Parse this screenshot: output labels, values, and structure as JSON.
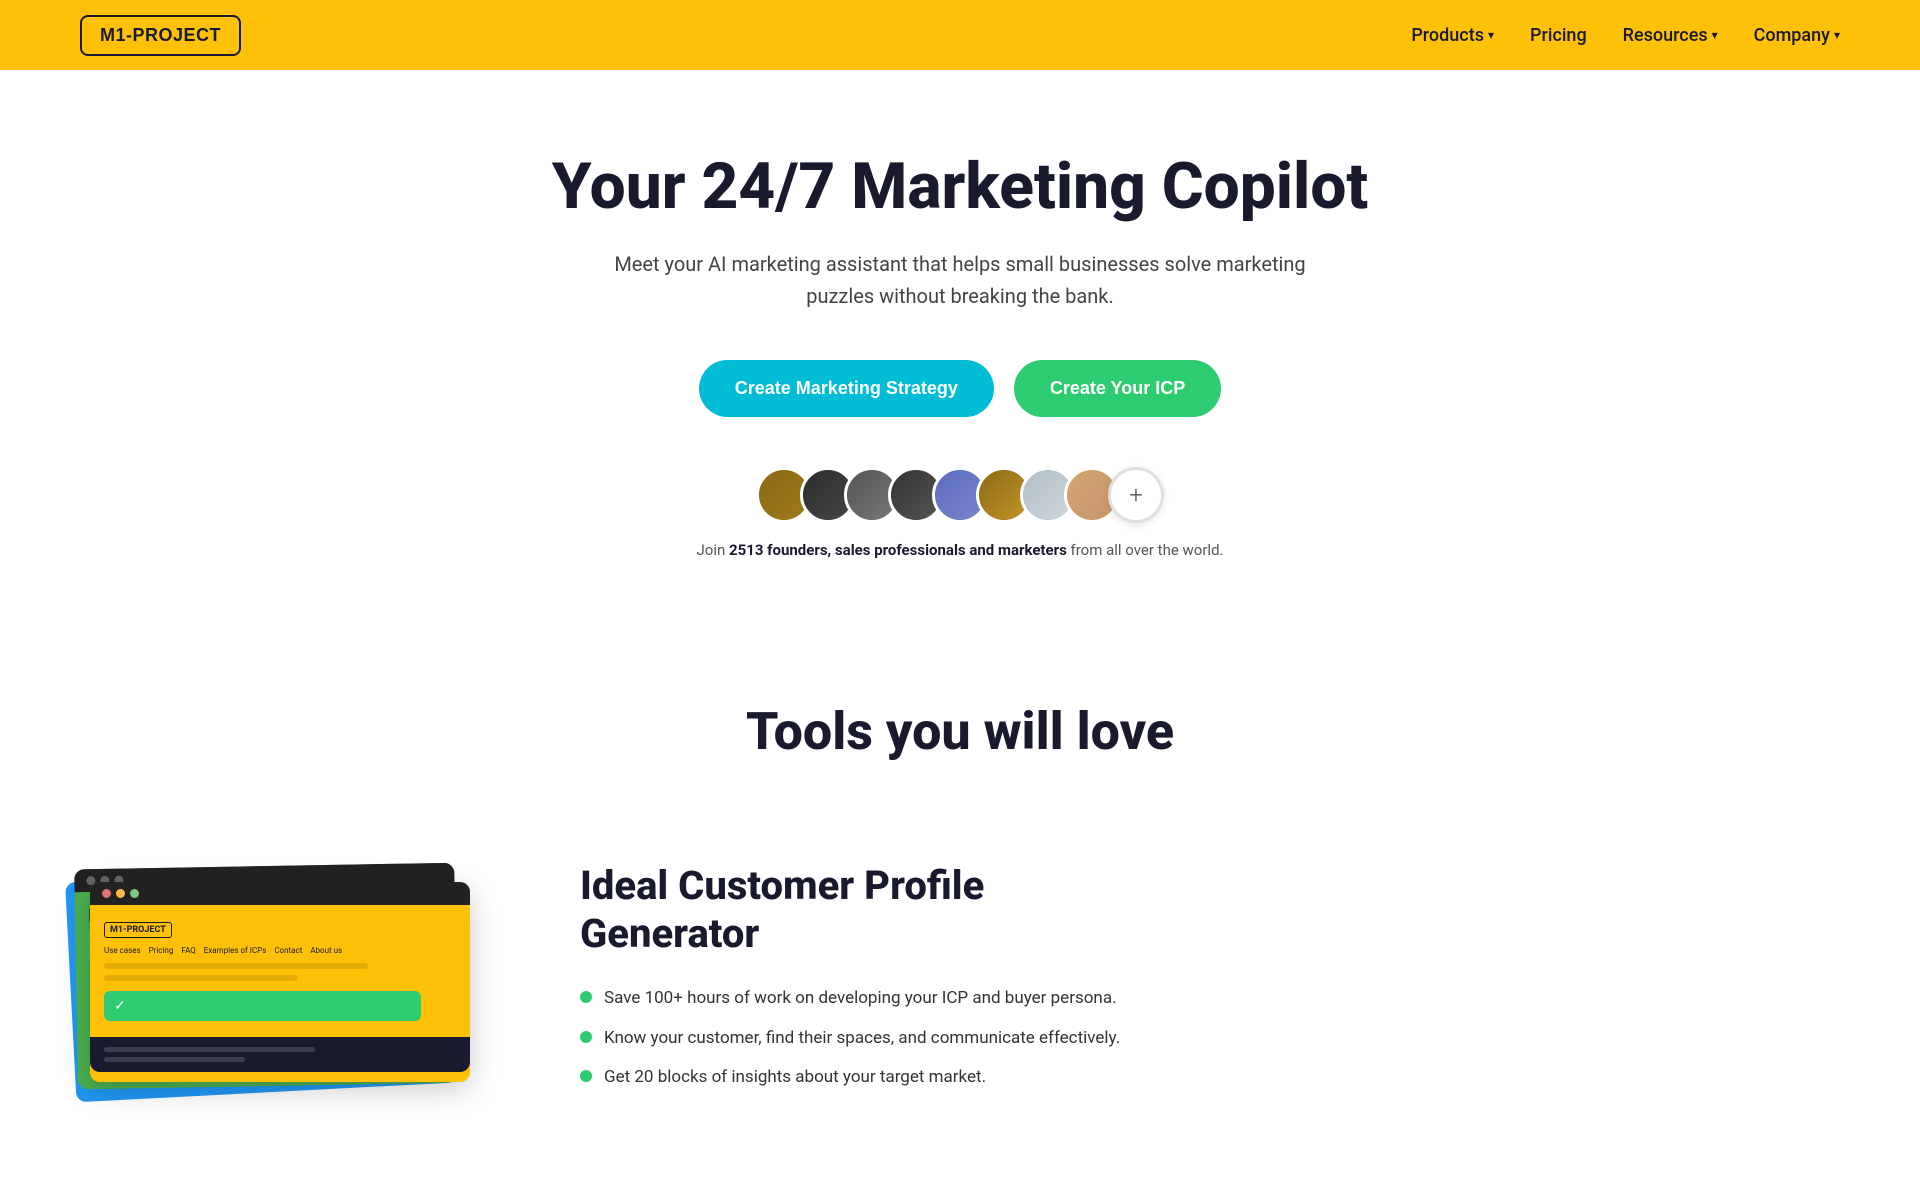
{
  "navbar": {
    "logo": "M1-PROJECT",
    "nav_items": [
      {
        "label": "Products",
        "has_dropdown": true
      },
      {
        "label": "Pricing",
        "has_dropdown": false
      },
      {
        "label": "Resources",
        "has_dropdown": true
      },
      {
        "label": "Company",
        "has_dropdown": true
      }
    ]
  },
  "hero": {
    "title": "Your 24/7 Marketing Copilot",
    "subtitle": "Meet your AI marketing assistant that helps small businesses solve marketing puzzles without breaking the bank.",
    "btn_strategy": "Create Marketing Strategy",
    "btn_icp": "Create Your ICP"
  },
  "social_proof": {
    "join_text_prefix": "Join ",
    "count_bold": "2513 founders, sales professionals and marketers",
    "join_text_suffix": " from all over the world."
  },
  "tools": {
    "section_title": "Tools you will love",
    "icp": {
      "title_line1": "Ideal Customer Profile",
      "title_line2": "Generator",
      "features": [
        "Save 100+ hours of work on developing your ICP and buyer persona.",
        "Know your customer, find their spaces, and communicate effectively.",
        "Get 20 blocks of insights about your target market."
      ]
    }
  },
  "colors": {
    "yellow": "#FFC107",
    "dark": "#1a1a2e",
    "cyan": "#00BCD4",
    "green": "#2ECC71"
  }
}
